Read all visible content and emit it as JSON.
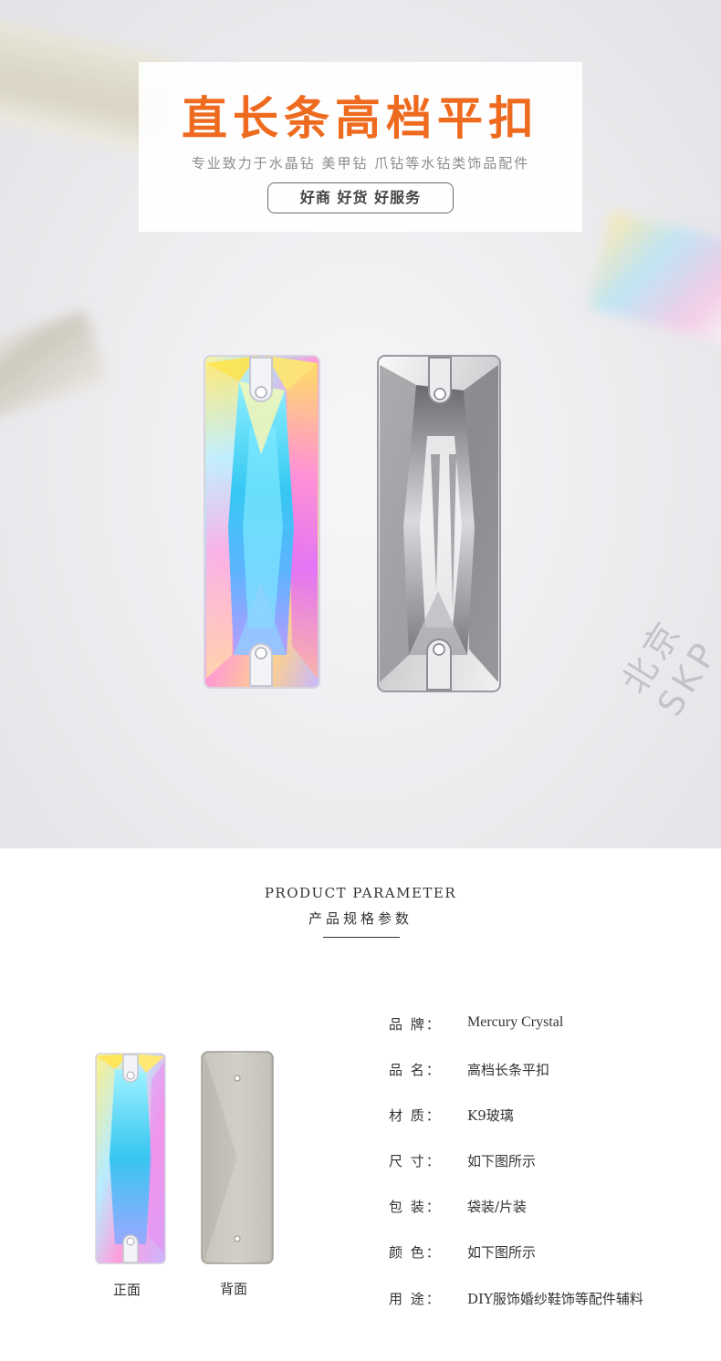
{
  "hero": {
    "title": "直长条高档平扣",
    "subtitle": "专业致力于水晶钻 美甲钻 爪钻等水钻类饰品配件",
    "slogan": "好商 好货 好服务",
    "watermark": "北京SKP"
  },
  "parameter": {
    "heading_en": "PRODUCT PARAMETER",
    "heading_cn": "产品规格参数",
    "captions": {
      "front": "正面",
      "back": "背面"
    },
    "specs": [
      {
        "label": "品 牌：",
        "value": "Mercury Crystal"
      },
      {
        "label": "品 名：",
        "value": "高档长条平扣"
      },
      {
        "label": "材 质：",
        "value": "K9玻璃"
      },
      {
        "label": "尺 寸：",
        "value": "如下图所示"
      },
      {
        "label": "包 装：",
        "value": "袋装/片装"
      },
      {
        "label": "颜 色：",
        "value": "如下图所示"
      },
      {
        "label": "用 途：",
        "value": "DIY服饰婚纱鞋饰等配件辅料"
      }
    ]
  },
  "colors": {
    "title_orange": "#ee6a1f",
    "text_dark": "#333333",
    "text_grey": "#8c8c8c"
  }
}
